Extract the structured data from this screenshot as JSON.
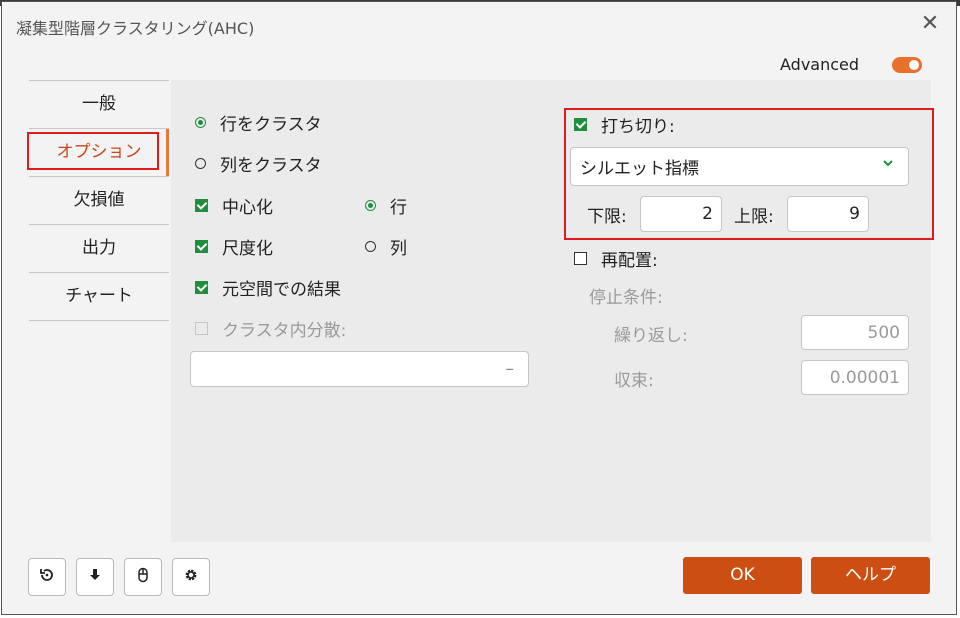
{
  "dialog": {
    "title": "凝集型階層クラスタリング(AHC)",
    "advanced_label": "Advanced",
    "close_glyph": "✕"
  },
  "tabs": [
    {
      "label": "一般"
    },
    {
      "label": "オプション"
    },
    {
      "label": "欠損値"
    },
    {
      "label": "出力"
    },
    {
      "label": "チャート"
    }
  ],
  "options": {
    "cluster_rows": "行をクラスタ",
    "cluster_cols": "列をクラスタ",
    "centering": "中心化",
    "centering_row": "行",
    "scaling": "尺度化",
    "scaling_col": "列",
    "original_space": "元空間での結果",
    "within_variance": "クラスタ内分散:",
    "within_variance_value": "",
    "within_variance_arrow": "–"
  },
  "truncation": {
    "label": "打ち切り:",
    "criterion": "シルエット指標",
    "lower_label": "下限:",
    "lower_value": "2",
    "upper_label": "上限:",
    "upper_value": "9"
  },
  "reassign": {
    "label": "再配置:",
    "stop_label": "停止条件:",
    "iter_label": "繰り返し:",
    "iter_value": "500",
    "conv_label": "収束:",
    "conv_value": "0.00001"
  },
  "footer": {
    "ok_label": "OK",
    "help_label": "ヘルプ"
  },
  "colors": {
    "accent": "#cc4e12",
    "check_green": "#1f8f3e",
    "highlight_red": "#e01b1b"
  }
}
